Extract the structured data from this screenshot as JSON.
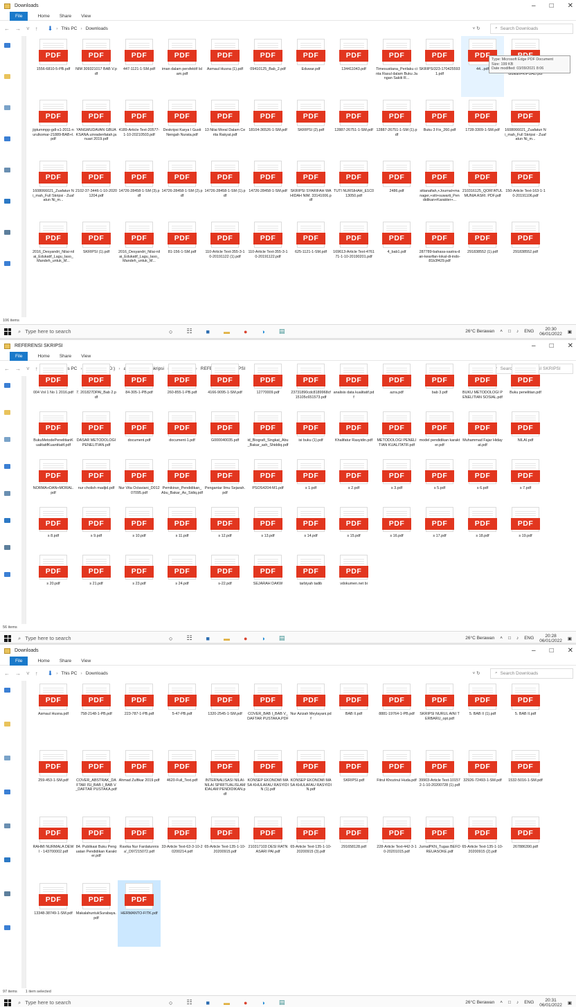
{
  "collage": {
    "shots": [
      {
        "id": "downloads_a",
        "window_title": "Downloads",
        "ribbon": {
          "file": "File",
          "tabs": [
            "Home",
            "Share",
            "View"
          ]
        },
        "path": [
          "This PC",
          "Downloads"
        ],
        "search_placeholder": "Search Downloads",
        "status_count": "106 items",
        "status_selected": "",
        "taskbar": {
          "search_placeholder": "Type here to search",
          "weather": "26°C Berawan",
          "lang": "ENG",
          "time": "20:30",
          "date": "06/01/2022"
        },
        "tooltip": {
          "type": "Type: Microsoft Edge PDF Document",
          "size": "Size: 199 KB",
          "modified": "Date modified: 03/09/2021 8:06"
        },
        "files": [
          "1556-6810-5-PB.pdf",
          "NIM 309321017 BAB V.pdf",
          "447-1121-1-SM.pdf",
          "iman dalam persfektif Islam.pdf",
          "Asmaul Husna (1).pdf",
          "09410125_Bab_2.pdf",
          "Eduwar.pdf",
          "134411043.pdf",
          "Timesustiana_Perilaku cinta Rasul dalam Buku Jangan Sakiti R...",
          "SKRIPSI323-1704255931.pdf",
          "44...pdf",
          "KASeminarNasionalPendidikanFKIPUAD.pdf",
          "jiptummpp-gdl-s1-2011-nurulkomar-21889-BAB+I.pdf",
          "YANGMUDAVAN GBUAKSANA.uinradenfatah.januari 2019.pdf",
          "4189-Article Text-20577-1-10-20210503.pdf",
          "Deskripsi Karya I Gusti Nengah Nurata.pdf",
          "13 Nilai Moral Dalam Cerita Rakyat.pdf",
          "18104-36526-1-SM.pdf",
          "SKRIPSI (2).pdf",
          "12887-26751-1-SM.pdf",
          "12887-26751-1-SM (1).pdf",
          "Buku 3 Fix_260.pdf",
          "1728-3309-1-SM.pdf",
          "1608066021_Zuafatun Ni_mah_Full Skripsi - Zuafatun Ni_m...",
          "1608066021_Zuafatun Ni_mah_Full Skripsi - Zuafatun Ni_m...",
          "2102-37-3446-1-10-20201204.pdf",
          "14726-28458-1-SM (3).pdf",
          "14726-28458-1-SM (2).pdf",
          "14726-28458-1-SM (1).pdf",
          "14726-28458-1-SM.pdf",
          "SKRIPSI SYARIFAH WAHIDAH NIM. 33141006.pdf",
          "TUTI NURSIHAH_E1C013050.pdf",
          "2486.pdf",
          "sitianafiah,+Journal+manager,+siti+suwarti_Pendidikan+Karakter+...",
          "210316125_QORI'ATUL MUNIA ASRI. PDF.pdf",
          "150-Article Text-163-1-10-20191106.pdf",
          "2016_Desyandri_Nilai-nilai_Edukatif_Lagu_Iaso_Mandeh_untuk_M...",
          "SKRIPSI (1).pdf",
          "2016_Desyandri_Nilai-nilai_Edukatif_Lagu_Iaso_Mandeh_untuk_M...",
          "81-156-1-SM.pdf",
          "110-Article Text-355-3-10-20191122 (1).pdf",
          "110-Article Text-355-3-10-20191122.pdf",
          "625-1121-1-SM.pdf",
          "169613-Article Text-476171-1-10-20190201.pdf",
          "4_bab1.pdf",
          "287789-bahasa-sastra-dan-kearifan-lokal-di-indo-81b3f429.pdf",
          "291838552 (1).pdf",
          "291838552.pdf"
        ]
      },
      {
        "id": "referensi",
        "window_title": "REFERENSI SKRIPSI",
        "ribbon": {
          "file": "File",
          "tabs": [
            "Home",
            "Share",
            "View"
          ]
        },
        "path": [
          "This PC",
          "Local Disk (D:)",
          "akademik",
          "skripsi",
          "file skripsi",
          "REFERENSI SKRIPSI"
        ],
        "search_placeholder": "Search REFERENSI SKRIPSI",
        "status_count": "56 items",
        "status_selected": "",
        "taskbar": {
          "search_placeholder": "Type here to search",
          "weather": "26°C Berawan",
          "lang": "ENG",
          "time": "20:28",
          "date": "06/01/2022"
        },
        "files": [
          "004 Vol 1 No 1 2016.pdf",
          "7. 201827DPAI_Bab 2.pdf",
          "84-305-1-PB.pdf",
          "260-855-1-PB.pdf",
          "4166-9095-1-SM.pdf",
          "12770009.pdf",
          "23731890cdc8189968cf15105c651573.pdf",
          "analisis data kualitatif.pdf",
          "azra.pdf",
          "bab 3.pdf",
          "BUKU METODOLOGI PENELITIAN SOSIAL.pdf",
          "Buku penelitian.pdf",
          "BukuMetodePenelitianKualitatifKuantitatif.pdf",
          "DASAR METODOLOGI PENELITIAN.pdf",
          "document.pdf",
          "document-1.pdf",
          "G000040035.pdf",
          "id_Biografi_Singkat_Abu_Bakar_ash_Shiddiq.pdf",
          "isi buku (1).pdf",
          "Khalifatur Rasyidin.pdf",
          "METODOLOGI PENELITIAN KUALITATIF.pdf",
          "model pendidikan karakter.pdf",
          "Muhammad Fajar Hidayat.pdf",
          "NILAI.pdf",
          "NORMA+DAN+MORAL.pdf",
          "nur cholish madjid.pdf",
          "Nur Vita Octaviani_D01207095.pdf",
          "Pemikiran_Pendidikan_Abu_Bakar_As_Sidiq.pdf",
          "Pengantar Ilmu Sejarah.pdf",
          "PSOS4204-M1.pdf",
          "s 1.pdf",
          "s 2.pdf",
          "s 3.pdf",
          "s 5.pdf",
          "s 6.pdf",
          "s 7.pdf",
          "s 8.pdf",
          "s 9.pdf",
          "s 10.pdf",
          "s 11.pdf",
          "s 12.pdf",
          "s 13.pdf",
          "s 14.pdf",
          "s 15.pdf",
          "s 16.pdf",
          "s 17.pdf",
          "s 18.pdf",
          "s 19.pdf",
          "s 20.pdf",
          "s 21.pdf",
          "s 23.pdf",
          "s 24.pdf",
          "s-22.pdf",
          "SEJARAH DAKW",
          "tarbiyah tadib",
          "vdokumen.net bi"
        ]
      },
      {
        "id": "downloads_b",
        "window_title": "Downloads",
        "ribbon": {
          "file": "File",
          "tabs": [
            "Home",
            "Share",
            "View"
          ]
        },
        "path": [
          "This PC",
          "Downloads"
        ],
        "search_placeholder": "Search Downloads",
        "status_count": "97 items",
        "status_selected": "1 item selected",
        "taskbar": {
          "search_placeholder": "Type here to search",
          "weather": "26°C Berawan",
          "lang": "ENG",
          "time": "20:31",
          "date": "06/01/2022"
        },
        "files": [
          "Asmaul Husna.pdf",
          "758-2148-1-PB.pdf",
          "223-787-1-PB.pdf",
          "5-47-PB.pdf",
          "1320-2545-1-SM.pdf",
          "COVER_BAB I_BAB V_DAFTAR PUSTAKA.PDF",
          "Nur Azizah Meylayani.pdf",
          "BAB II.pdf",
          "8881-19764-1-PB.pdf",
          "SKRIPSI NURUL AINI TERBARU_opt.pdf",
          "5. BAB II (1).pdf",
          "5. BAB II.pdf",
          "259-453-1-SM.pdf",
          "COVER_ABSTRAK_DAFTAR ISI_BAB I_BAB V_DAFTAR PUSTAKA.pdf",
          "Ahmad Zulfikar 2019.pdf",
          "4620-Full_Text.pdf",
          "INTERNALISASI NILAI-NILAI SPIRITUALISLAMIDALAM PENDIDIKAN.pdf",
          "KONSEP EKONOMI MASA KHULAFAU RASYIDIN (1).pdf",
          "KONSEP EKONOMI MASA KHULAFAU RASYIDIN.pdf",
          "SKRIPSI.pdf",
          "Fitrul Khozinul Huda.pdf",
          "39903-Article Text-101572-1-10-20200728 (1).pdf",
          "32926-72493-1-SM.pdf",
          "1532-5016-1-SM.pdf",
          "RAHMI NURMALA DEWI - 143700002.pdf",
          "84. Publikasi Buku Penguatan Pendidikan Karakter.pdf",
          "Ravika Nur Fardatunnisa'_D97215072.pdf",
          "33-Article Text-63-3-10-20200214.pdf",
          "65-Article Text-135-1-10-20200915.pdf",
          "210317103 DESI RATNASARI PAI.pdf",
          "65-Article Text-135-1-10-20200915 (3).pdf",
          "291658128.pdf",
          "228-Article Text-442-3-10-20201015.pdf",
          "JurnalPKN_Tugas BEFOREUASOKE.pdf",
          "65-Article Text-135-1-10-20200915 (2).pdf",
          "267886390.pdf",
          "13348-38749-1-SM.pdf",
          "MakalahuntukSurabaya.pdf",
          "HERMANTO-FITK.pdf"
        ]
      }
    ]
  }
}
